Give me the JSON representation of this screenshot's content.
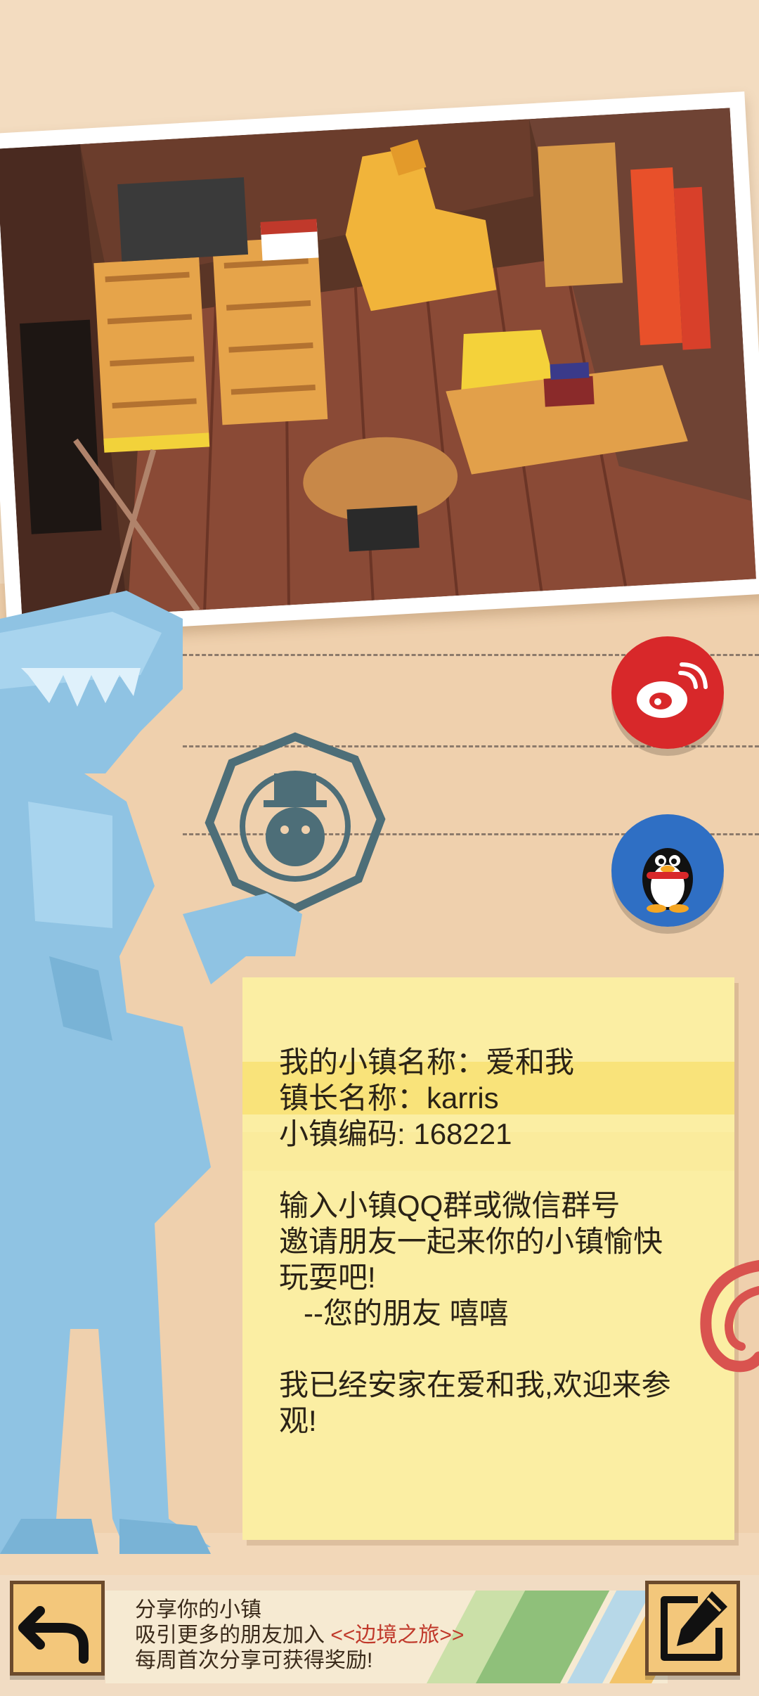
{
  "screenshot": {
    "photo_alt": "小镇室内截图"
  },
  "share": {
    "weibo_icon": "weibo-icon",
    "qq_icon": "qq-penguin-icon"
  },
  "note": {
    "lines": [
      "我的小镇名称：爱和我",
      "镇长名称：karris",
      "小镇编码: 168221",
      "",
      "输入小镇QQ群或微信群号",
      "邀请朋友一起来你的小镇愉快",
      "玩耍吧!",
      "   --您的朋友 嘻嘻",
      "",
      "我已经安家在爱和我,欢迎来参",
      "观!"
    ]
  },
  "bottom": {
    "back_icon": "back-arrow-icon",
    "edit_icon": "edit-pen-icon",
    "banner_line1": "分享你的小镇",
    "banner_line2_prefix": "吸引更多的朋友加入 ",
    "banner_line2_highlight": "<<边境之旅>>",
    "banner_line3": "每周首次分享可获得奖励!"
  },
  "colors": {
    "weibo_red": "#d8282a",
    "qq_blue": "#2f6fc4",
    "note_yellow": "#fbeea3",
    "dino_blue": "#8fc3e3",
    "button_orange": "#f3c77b"
  }
}
